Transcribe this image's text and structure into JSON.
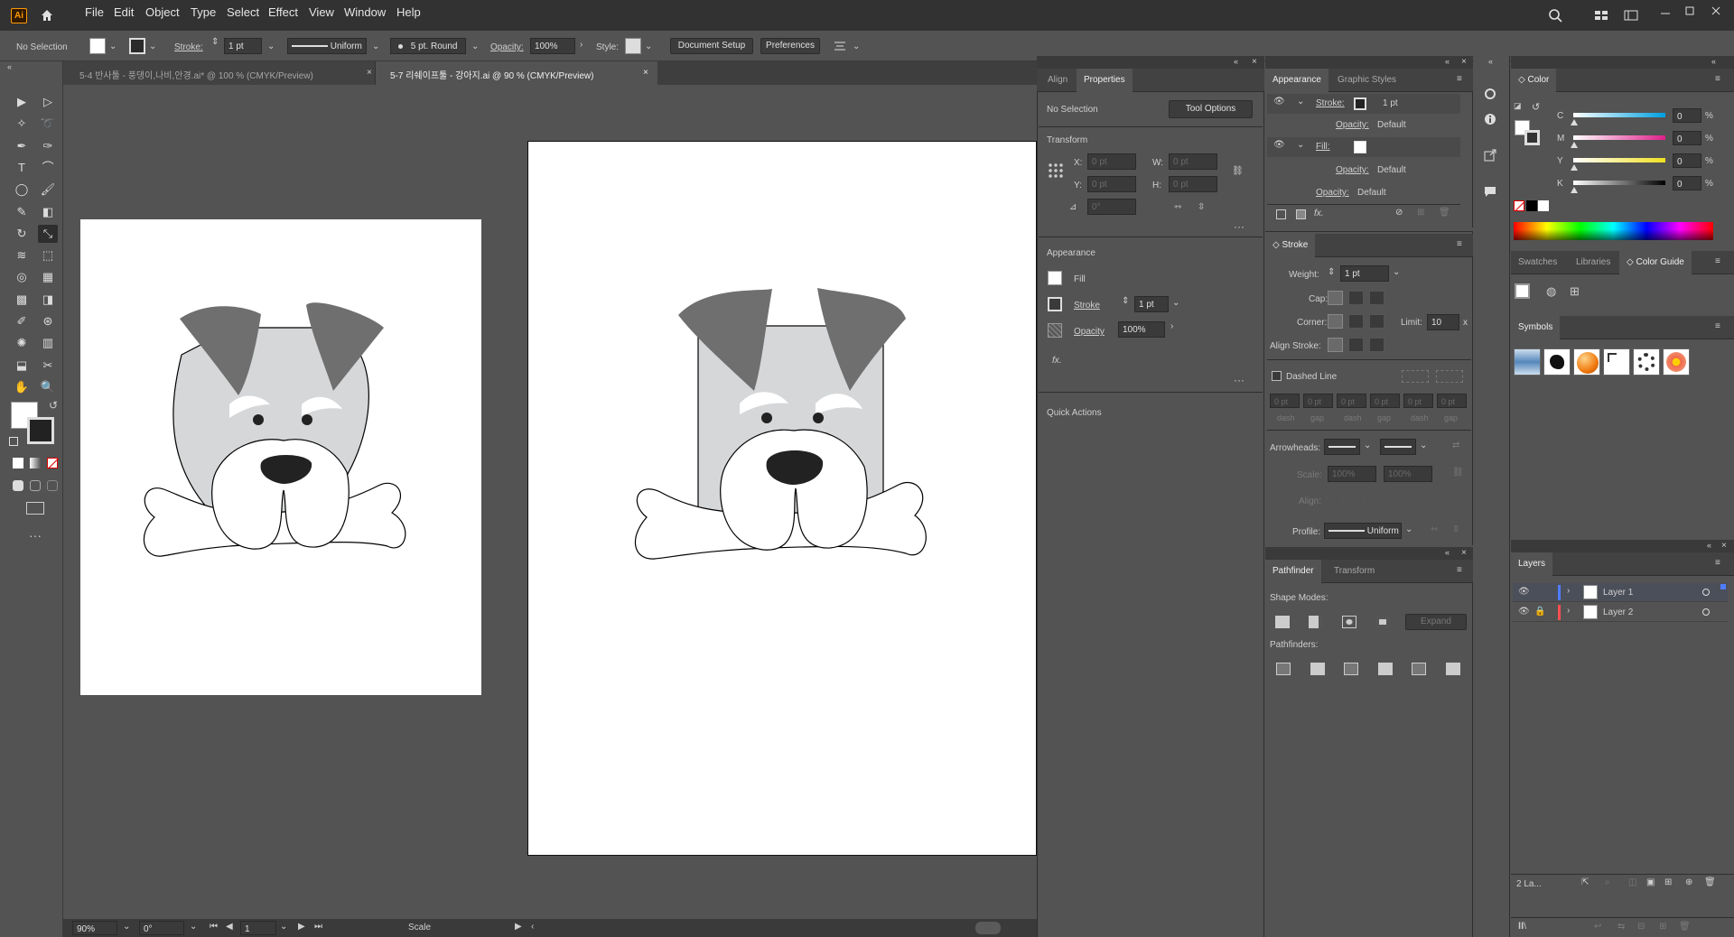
{
  "app": {
    "logo": "Ai"
  },
  "menu": [
    "File",
    "Edit",
    "Object",
    "Type",
    "Select",
    "Effect",
    "View",
    "Window",
    "Help"
  ],
  "control_bar": {
    "selection": "No Selection",
    "stroke_label": "Stroke:",
    "stroke_weight": "1 pt",
    "stroke_profile": "Uniform",
    "brush": "5 pt. Round",
    "opacity_label": "Opacity:",
    "opacity": "100%",
    "style_label": "Style:",
    "doc_setup": "Document Setup",
    "preferences": "Preferences"
  },
  "doc_tabs": [
    {
      "label": "5-4 반사툴 - 풍댕이,나비,안경.ai* @ 100 % (CMYK/Preview)"
    },
    {
      "label": "5-7 리쉐이프툴 - 강아지.ai @ 90 % (CMYK/Preview)"
    }
  ],
  "status_bar": {
    "zoom": "90%",
    "rotation": "0°",
    "artboard": "1",
    "tool": "Scale"
  },
  "properties_panel": {
    "tabs": [
      "Align",
      "Properties"
    ],
    "selection": "No Selection",
    "tool_options": "Tool Options",
    "transform_title": "Transform",
    "x_label": "X:",
    "x": "0 pt",
    "y_label": "Y:",
    "y": "0 pt",
    "w_label": "W:",
    "w": "0 pt",
    "h_label": "H:",
    "h": "0 pt",
    "angle": "0°",
    "appearance_title": "Appearance",
    "fill": "Fill",
    "stroke": "Stroke",
    "stroke_weight": "1 pt",
    "opacity": "Opacity",
    "opacity_value": "100%",
    "fx": "fx.",
    "quick_actions": "Quick Actions"
  },
  "appearance_panel": {
    "tabs": [
      "Appearance",
      "Graphic Styles"
    ],
    "stroke_label": "Stroke:",
    "stroke_value": "1 pt",
    "opacity_label": "Opacity:",
    "opacity_value": "Default",
    "fill_label": "Fill:",
    "fx": "fx."
  },
  "stroke_panel": {
    "title": "Stroke",
    "weight_label": "Weight:",
    "weight": "1 pt",
    "cap_label": "Cap:",
    "corner_label": "Corner:",
    "limit_label": "Limit:",
    "limit": "10",
    "limit_unit": "x",
    "align_label": "Align Stroke:",
    "dashed_label": "Dashed Line",
    "dash_values": [
      "0 pt",
      "0 pt",
      "0 pt",
      "0 pt",
      "0 pt",
      "0 pt"
    ],
    "dash_labels": [
      "dash",
      "gap",
      "dash",
      "gap",
      "dash",
      "gap"
    ],
    "arrowheads_label": "Arrowheads:",
    "scale_label": "Scale:",
    "scale_1": "100%",
    "scale_2": "100%",
    "align_arrow_label": "Align:",
    "profile_label": "Profile:",
    "profile": "Uniform"
  },
  "pathfinder_panel": {
    "tabs": [
      "Pathfinder",
      "Transform"
    ],
    "shape_modes": "Shape Modes:",
    "expand": "Expand",
    "pathfinders": "Pathfinders:"
  },
  "color_panel": {
    "title": "Color",
    "channels": [
      {
        "label": "C",
        "value": "0",
        "unit": "%",
        "gradient_end": "#00a0e0"
      },
      {
        "label": "M",
        "value": "0",
        "unit": "%",
        "gradient_end": "#e0208a"
      },
      {
        "label": "Y",
        "value": "0",
        "unit": "%",
        "gradient_end": "#f0e020"
      },
      {
        "label": "K",
        "value": "0",
        "unit": "%",
        "gradient_end": "#000000"
      }
    ]
  },
  "swatch_tabs": [
    "Swatches",
    "Libraries",
    "Color Guide"
  ],
  "symbols_title": "Symbols",
  "layers_panel": {
    "title": "Layers",
    "layers": [
      {
        "name": "Layer 1",
        "color": "#4f7cff"
      },
      {
        "name": "Layer 2",
        "color": "#ff4f4f"
      }
    ],
    "count": "2 La..."
  }
}
